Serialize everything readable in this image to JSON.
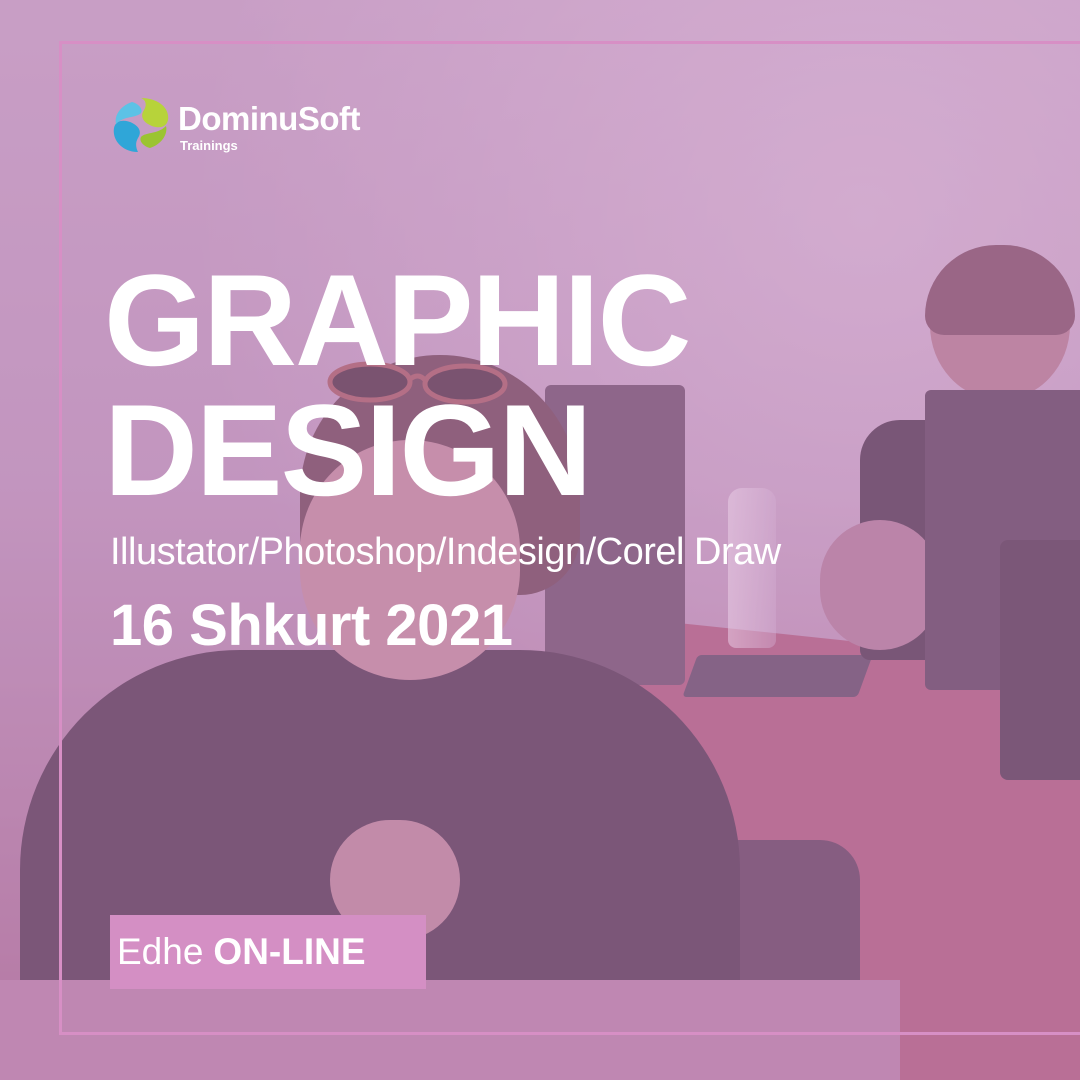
{
  "brand": {
    "name": "DominuSoft",
    "tagline": "Trainings",
    "colors": {
      "accent_green": "#b7d33a",
      "accent_blue": "#2fa6d8",
      "frame_pink": "#d78fc5"
    }
  },
  "headline": {
    "line1": "GRAPHIC",
    "line2": "DESIGN"
  },
  "software": "Illustator/Photoshop/Indesign/Corel Draw",
  "date": "16 Shkurt 2021",
  "badge": {
    "prefix": "Edhe",
    "highlight": "ON-LINE"
  }
}
